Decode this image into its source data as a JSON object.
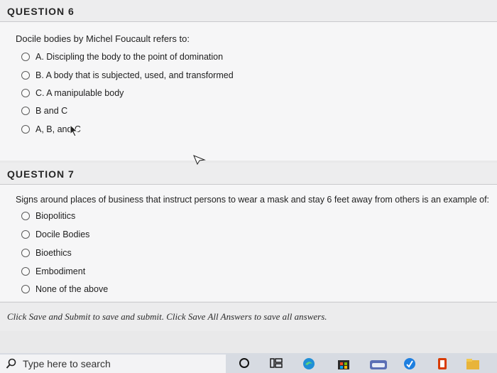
{
  "question6": {
    "title": "QUESTION 6",
    "prompt": "Docile bodies by Michel Foucault refers to:",
    "options": [
      "A. Discipling the body to the point of domination",
      "B. A body that is subjected, used, and transformed",
      "C. A manipulable body",
      "B and C",
      "A, B, and C"
    ]
  },
  "question7": {
    "title": "QUESTION 7",
    "prompt": "Signs around places of business that instruct persons to wear a mask and stay 6 feet away from others is an example of:",
    "options": [
      "Biopolitics",
      "Docile Bodies",
      "Bioethics",
      "Embodiment",
      "None of the above"
    ]
  },
  "footer": {
    "note": "Click Save and Submit to save and submit. Click Save All Answers to save all answers."
  },
  "taskbar": {
    "search_placeholder": "Type here to search",
    "icons": [
      "search-icon",
      "cortana-icon",
      "task-view-icon",
      "edge-icon",
      "store-icon",
      "app-icon",
      "teams-icon",
      "office-icon",
      "file-explorer-icon"
    ]
  }
}
